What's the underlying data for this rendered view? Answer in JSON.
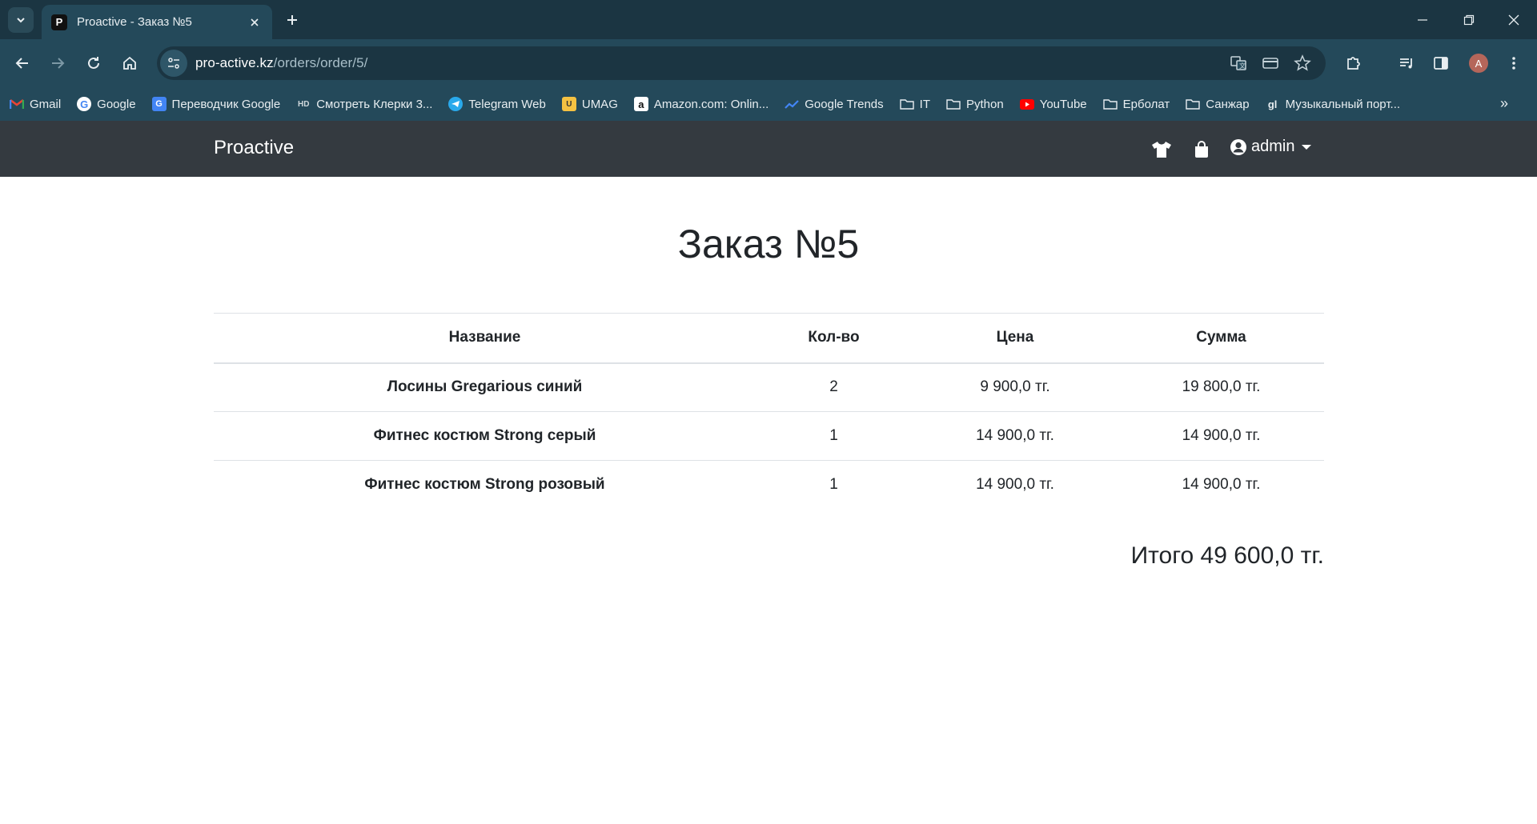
{
  "browser": {
    "tab_title": "Proactive - Заказ №5",
    "tab_favicon": "P",
    "url_host": "pro-active.kz",
    "url_path": "/orders/order/5/",
    "profile_initial": "A",
    "bookmarks": [
      {
        "label": "Gmail",
        "icon": "gmail-icon"
      },
      {
        "label": "Google",
        "icon": "google-icon"
      },
      {
        "label": "Переводчик Google",
        "icon": "translate-icon"
      },
      {
        "label": "Смотреть Клерки 3...",
        "icon": "hd-icon"
      },
      {
        "label": "Telegram Web",
        "icon": "telegram-icon"
      },
      {
        "label": "UMAG",
        "icon": "umag-icon"
      },
      {
        "label": "Amazon.com: Onlin...",
        "icon": "amazon-icon"
      },
      {
        "label": "Google Trends",
        "icon": "trends-icon"
      },
      {
        "label": "IT",
        "icon": "folder-icon"
      },
      {
        "label": "Python",
        "icon": "folder-icon"
      },
      {
        "label": "YouTube",
        "icon": "youtube-icon"
      },
      {
        "label": "Ерболат",
        "icon": "folder-icon"
      },
      {
        "label": "Санжар",
        "icon": "folder-icon"
      },
      {
        "label": "Музыкальный порт...",
        "icon": "music-portal-icon"
      }
    ]
  },
  "site": {
    "brand": "Proactive",
    "user_label": "admin"
  },
  "order": {
    "title": "Заказ №5",
    "headers": {
      "name": "Название",
      "qty": "Кол-во",
      "price": "Цена",
      "sum": "Сумма"
    },
    "rows": [
      {
        "name": "Лосины Gregarious синий",
        "qty": "2",
        "price": "9 900,0 тг.",
        "sum": "19 800,0 тг."
      },
      {
        "name": "Фитнес костюм Strong серый",
        "qty": "1",
        "price": "14 900,0 тг.",
        "sum": "14 900,0 тг."
      },
      {
        "name": "Фитнес костюм Strong розовый",
        "qty": "1",
        "price": "14 900,0 тг.",
        "sum": "14 900,0 тг."
      }
    ],
    "total": "Итого 49 600,0 тг."
  },
  "colors": {
    "chrome_dark": "#1b3542",
    "chrome_light": "#24495a",
    "site_nav": "#343a40",
    "text": "#212529"
  }
}
